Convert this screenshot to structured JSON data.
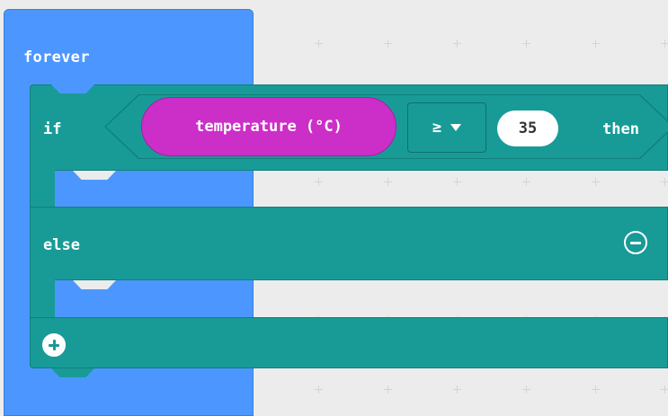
{
  "workspace": {
    "forever_label": "forever",
    "if_keyword": "if",
    "then_keyword": "then",
    "else_keyword": "else",
    "condition": {
      "sensor_label": "temperature (°C)",
      "operator": "≥",
      "value": "35"
    },
    "icons": {
      "remove_else": "minus-circle-icon",
      "add_branch": "plus-circle-icon"
    }
  },
  "colors": {
    "workspace_bg": "#ececec",
    "basic_block": "#4c97ff",
    "logic_block": "#189b97",
    "input_block": "#cc2ec8"
  }
}
